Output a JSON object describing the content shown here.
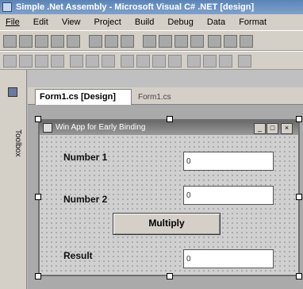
{
  "window": {
    "title": "Simple .Net Assembly - Microsoft Visual C# .NET [design]"
  },
  "menu": {
    "items": [
      "File",
      "Edit",
      "View",
      "Project",
      "Build",
      "Debug",
      "Data",
      "Format"
    ]
  },
  "tabs": [
    {
      "label": "Form1.cs [Design]",
      "active": true
    },
    {
      "label": "Form1.cs",
      "active": false
    }
  ],
  "toolbox": {
    "label": "Toolbox"
  },
  "form": {
    "title": "Win App for Early Binding",
    "fields": [
      {
        "label": "Number 1",
        "value": "0"
      },
      {
        "label": "Number 2",
        "value": "0"
      },
      {
        "label": "Result",
        "value": "0"
      }
    ],
    "multiply_label": "Multiply"
  }
}
